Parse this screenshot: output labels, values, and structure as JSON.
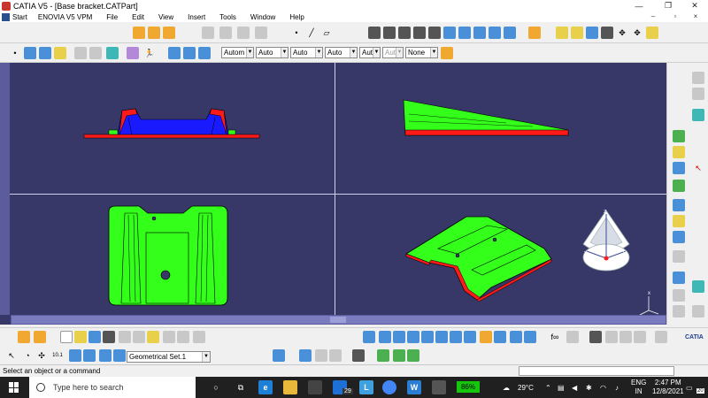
{
  "window": {
    "title": "CATIA V5 - [Base bracket.CATPart]",
    "minimize": "—",
    "maximize": "❐",
    "close": "✕"
  },
  "menu": {
    "start": "Start",
    "items": [
      "ENOVIA V5 VPM",
      "File",
      "Edit",
      "View",
      "Insert",
      "Tools",
      "Window",
      "Help"
    ]
  },
  "toolbar2": {
    "selects": [
      "Autom",
      "Auto",
      "Auto",
      "Auto",
      "Aut",
      "Aut",
      "None"
    ]
  },
  "bottom_toolbar": {
    "geometrical_set": "Geometrical Set.1"
  },
  "status": {
    "message": "Select an object or a command"
  },
  "taskbar": {
    "search_placeholder": "Type here to search",
    "battery": "86%",
    "temperature": "29°C",
    "language": "ENG",
    "region": "IN",
    "time": "2:47 PM",
    "date": "12/8/2021",
    "notification_count": "20",
    "mail_badge": "29"
  },
  "viewport": {
    "compass_label_z": "z",
    "compass_label_x": "x",
    "compass_label_y": "y",
    "axis_label": "x",
    "catia_brand": "CATIA"
  },
  "colors": {
    "viewport_bg": "#373768",
    "part_green": "#33ff1a",
    "part_blue": "#1a1aff",
    "part_red": "#ff1a1a"
  }
}
